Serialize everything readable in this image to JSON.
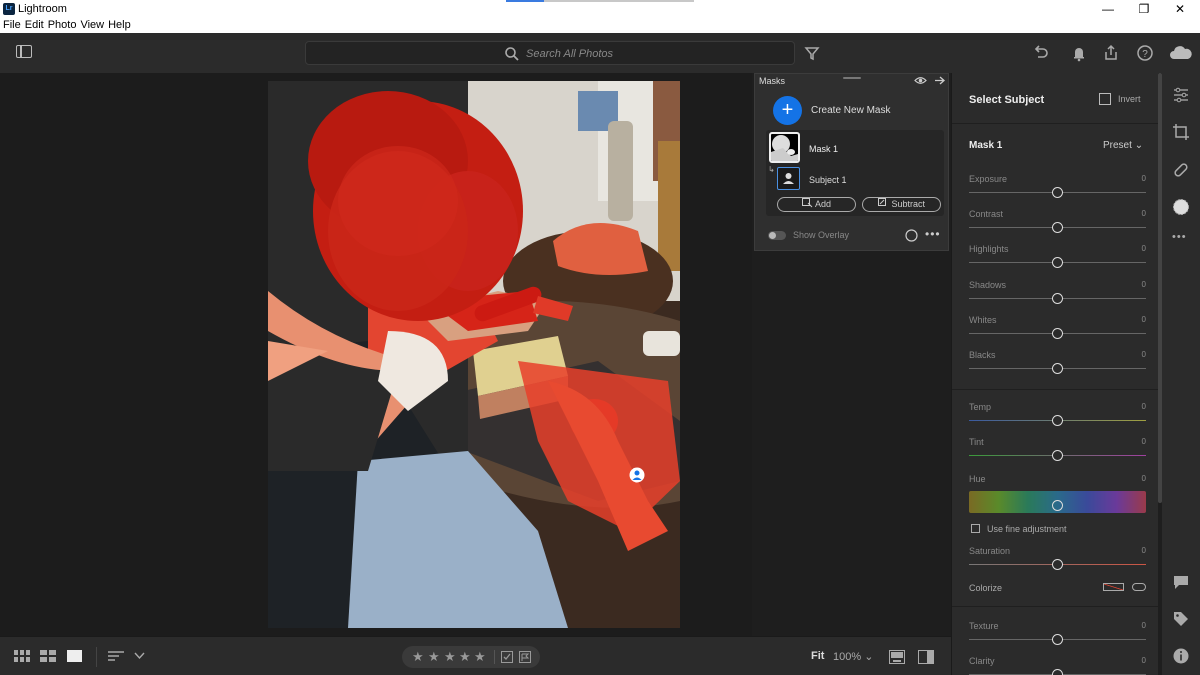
{
  "window": {
    "app_icon_text": "Lr",
    "title": "Lightroom",
    "controls": {
      "minimize": "—",
      "maximize": "❐",
      "close": "✕"
    }
  },
  "menu": [
    "File",
    "Edit",
    "Photo",
    "View",
    "Help"
  ],
  "header": {
    "search_placeholder": "Search All Photos",
    "icons": [
      "panel-toggle-icon",
      "search-icon",
      "filter-icon",
      "undo-icon",
      "bell-icon",
      "share-icon",
      "help-icon",
      "cloud-icon"
    ]
  },
  "masks_panel": {
    "title": "Masks",
    "create_label": "Create New Mask",
    "mask_name": "Mask 1",
    "component_name": "Subject 1",
    "add_label": "Add",
    "subtract_label": "Subtract",
    "overlay_label": "Show Overlay"
  },
  "edit_panel": {
    "heading": "Select Subject",
    "invert_label": "Invert",
    "mask_title": "Mask 1",
    "preset_label": "Preset",
    "sliders": [
      {
        "label": "Exposure",
        "value": "0"
      },
      {
        "label": "Contrast",
        "value": "0"
      },
      {
        "label": "Highlights",
        "value": "0"
      },
      {
        "label": "Shadows",
        "value": "0"
      },
      {
        "label": "Whites",
        "value": "0"
      },
      {
        "label": "Blacks",
        "value": "0"
      },
      {
        "label": "Temp",
        "value": "0"
      },
      {
        "label": "Tint",
        "value": "0"
      },
      {
        "label": "Hue",
        "value": "0"
      },
      {
        "label": "Saturation",
        "value": "0"
      },
      {
        "label": "Texture",
        "value": "0"
      },
      {
        "label": "Clarity",
        "value": "0"
      }
    ],
    "fine_adjust_label": "Use fine adjustment",
    "colorize_label": "Colorize"
  },
  "bottom": {
    "fit_label": "Fit",
    "zoom_label": "100%",
    "rating_stars": 5
  },
  "colors": {
    "accent": "#1473e6",
    "mask_overlay": "#e0251a"
  }
}
